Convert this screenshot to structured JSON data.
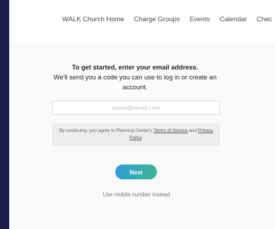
{
  "nav": {
    "items": [
      "WALK Church Home",
      "Charge Groups",
      "Events",
      "Calendar",
      "Chec"
    ]
  },
  "intro": {
    "line1": "To get started, enter your email address.",
    "line2": "We'll send you a code you can use to log in or create an account."
  },
  "email": {
    "placeholder": "name@email.com",
    "value": ""
  },
  "consent": {
    "prefix": "By continuing, you agree to Planning Center's ",
    "terms_label": "Terms of Service",
    "and": " and ",
    "privacy_label": "Privacy Policy",
    "suffix": "."
  },
  "next_button": {
    "label": "Next"
  },
  "alt_login": {
    "label": "Use mobile number instead"
  },
  "colors": {
    "frame": "#1c1a4a",
    "button_gradient_start": "#2c9fd8",
    "button_gradient_end": "#3bb593"
  }
}
